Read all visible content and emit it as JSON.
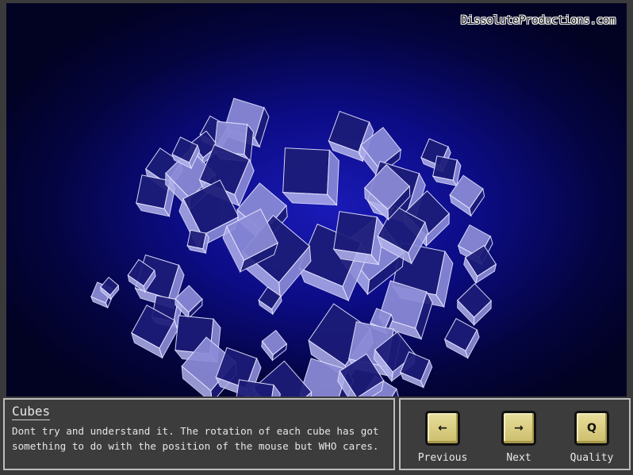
{
  "brand": {
    "text": "DissoluteProductions.com"
  },
  "info": {
    "title": "Cubes",
    "description": "Dont try and understand it. The rotation of each cube has got something to do with the position of the mouse but WHO cares."
  },
  "controls": {
    "previous": {
      "key": "←",
      "label": "Previous"
    },
    "next": {
      "key": "→",
      "label": "Next"
    },
    "quality": {
      "key": "Q",
      "label": "Quality"
    }
  },
  "colors": {
    "background": "#0c0c86",
    "cube_face_light": "#8c8cd8",
    "cube_face_dark": "#1c1c78",
    "cube_edge": "#e8e8ff",
    "panel": "#3c3c3c",
    "key": "#dccf84"
  }
}
